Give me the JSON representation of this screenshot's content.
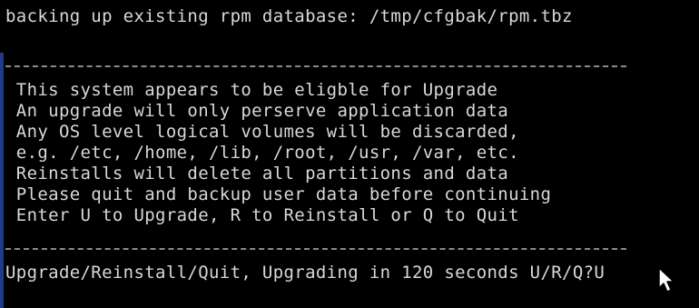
{
  "terminal": {
    "status_line": "backing up existing rpm database: /tmp/cfgbak/rpm.tbz",
    "message_lines": [
      " This system appears to be eligble for Upgrade",
      " An upgrade will only perserve application data",
      " Any OS level logical volumes will be discarded,",
      " e.g. /etc, /home, /lib, /root, /usr, /var, etc.",
      " Reinstalls will delete all partitions and data",
      " Please quit and backup user data before continuing",
      " Enter U to Upgrade, R to Reinstall or Q to Quit"
    ],
    "prompt": "Upgrade/Reinstall/Quit, Upgrading in 120 seconds U/R/Q?",
    "input_value": "U"
  },
  "colors": {
    "background": "#000000",
    "text": "#d8d8d8",
    "rule": "#8a8a8a",
    "left_bar": "#1f3b8a"
  },
  "icons": {
    "cursor": "mouse-pointer-icon"
  }
}
